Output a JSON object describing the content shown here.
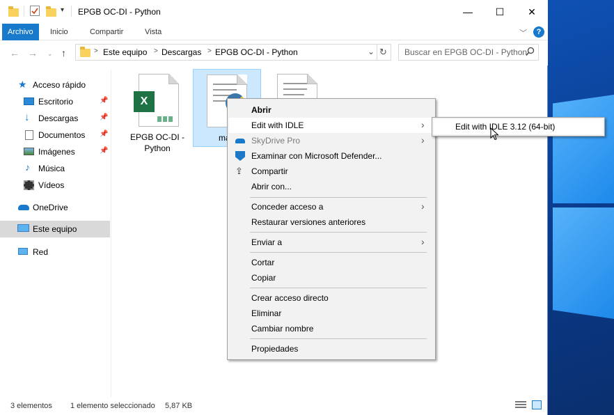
{
  "window": {
    "title": "EPGB OC-DI - Python",
    "controls": {
      "minimize": "—",
      "maximize": "☐",
      "close": "✕"
    }
  },
  "ribbon": {
    "tabs": [
      "Archivo",
      "Inicio",
      "Compartir",
      "Vista"
    ],
    "help": "?"
  },
  "address": {
    "segments": [
      "Este equipo",
      "Descargas",
      "EPGB OC-DI - Python"
    ],
    "separator": ">"
  },
  "search": {
    "placeholder": "Buscar en EPGB OC-DI - Python"
  },
  "sidebar": {
    "items": [
      {
        "label": "Acceso rápido",
        "icon": "star-icon"
      },
      {
        "label": "Escritorio",
        "icon": "desktop-icon",
        "pinned": true
      },
      {
        "label": "Descargas",
        "icon": "download-icon",
        "pinned": true
      },
      {
        "label": "Documentos",
        "icon": "documents-icon",
        "pinned": true
      },
      {
        "label": "Imágenes",
        "icon": "pictures-icon",
        "pinned": true
      },
      {
        "label": "Música",
        "icon": "music-icon"
      },
      {
        "label": "Vídeos",
        "icon": "videos-icon"
      },
      {
        "label": "OneDrive",
        "icon": "cloud-icon"
      },
      {
        "label": "Este equipo",
        "icon": "computer-icon",
        "selected": true
      },
      {
        "label": "Red",
        "icon": "network-icon"
      }
    ]
  },
  "files": [
    {
      "name_line1": "EPGB OC-DI -",
      "name_line2": "Python",
      "type": "excel"
    },
    {
      "name_line1": "main",
      "type": "python",
      "selected": true
    },
    {
      "name_line1": "",
      "type": "python"
    }
  ],
  "status": {
    "count": "3 elementos",
    "selection": "1 elemento seleccionado",
    "size": "5,87 KB"
  },
  "context_menu": {
    "items": [
      {
        "label": "Abrir",
        "bold": true
      },
      {
        "label": "Edit with IDLE",
        "submenu": true,
        "hover": true
      },
      {
        "label": "SkyDrive Pro",
        "submenu": true,
        "disabled": true,
        "icon": "cloud-icon"
      },
      {
        "label": "Examinar con Microsoft Defender...",
        "icon": "shield-icon"
      },
      {
        "label": "Compartir",
        "icon": "share-icon"
      },
      {
        "label": "Abrir con..."
      },
      {
        "label": "Conceder acceso a",
        "submenu": true
      },
      {
        "label": "Restaurar versiones anteriores"
      },
      {
        "label": "Enviar a",
        "submenu": true
      },
      {
        "label": "Cortar"
      },
      {
        "label": "Copiar"
      },
      {
        "label": "Crear acceso directo"
      },
      {
        "label": "Eliminar"
      },
      {
        "label": "Cambiar nombre"
      },
      {
        "label": "Propiedades"
      }
    ]
  },
  "submenu": {
    "label": "Edit with IDLE 3.12 (64-bit)"
  },
  "colors": {
    "accent": "#1979ca",
    "folder": "#f8d25c",
    "excel": "#1f7244",
    "python_blue": "#3b77a8"
  }
}
